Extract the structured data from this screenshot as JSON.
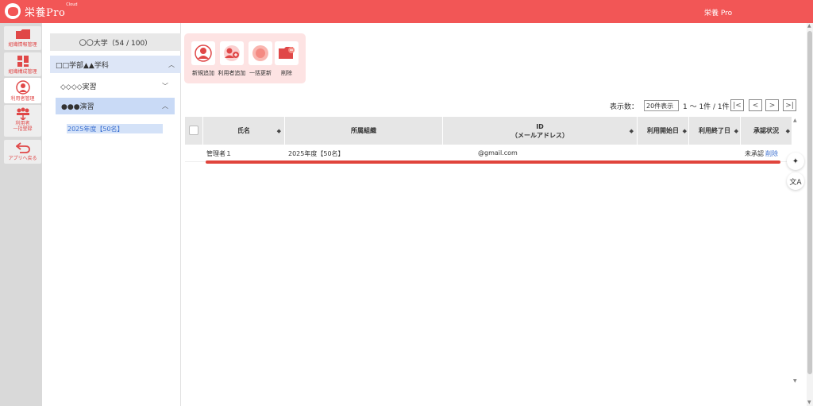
{
  "header": {
    "logo_text": "栄養Pro",
    "logo_sup": "Cloud",
    "title": "栄養 Pro"
  },
  "rail": {
    "items": [
      {
        "label": "組織情報管理",
        "icon": "folder-icon"
      },
      {
        "label": "組織構成管理",
        "icon": "layout-icon"
      },
      {
        "label": "利用者管理",
        "icon": "user-icon"
      },
      {
        "label_line1": "利用者",
        "label_line2": "一括登録",
        "icon": "users-upload-icon"
      },
      {
        "label": "アプリへ戻る",
        "icon": "return-icon"
      }
    ]
  },
  "sidebar": {
    "org_name": "〇〇大学（54 / 100）",
    "faculty": "□□学部▲▲学科",
    "course_a": "◇◇◇◇実習",
    "course_b": "●●●演習",
    "year_group": "2025年度【50名】"
  },
  "actions": [
    {
      "label": "新規追加",
      "icon": "person-icon"
    },
    {
      "label": "利用者追加",
      "icon": "add-user-icon"
    },
    {
      "label": "一括更新",
      "icon": "refresh-icon"
    },
    {
      "label": "削除",
      "icon": "delete-folder-icon"
    }
  ],
  "paging": {
    "display_label": "表示数：",
    "per_page": "20件表示",
    "range": "1 〜 1件 / 1件",
    "first": "|<",
    "prev": "<",
    "next": ">",
    "last": ">|"
  },
  "table": {
    "columns": [
      "氏名",
      "所属組織",
      "ID",
      "（メールアドレス）",
      "利用開始日",
      "利用終了日",
      "承認状況"
    ],
    "rows": [
      {
        "name": "管理者１",
        "org": "2025年度【50名】",
        "email": "@gmail.com",
        "start": "",
        "end": "",
        "status": "未承認",
        "action": "削除"
      }
    ]
  },
  "colors": {
    "brand": "#f25656",
    "accent_blue": "#3a6fd0",
    "action_panel": "#fde3e3"
  }
}
